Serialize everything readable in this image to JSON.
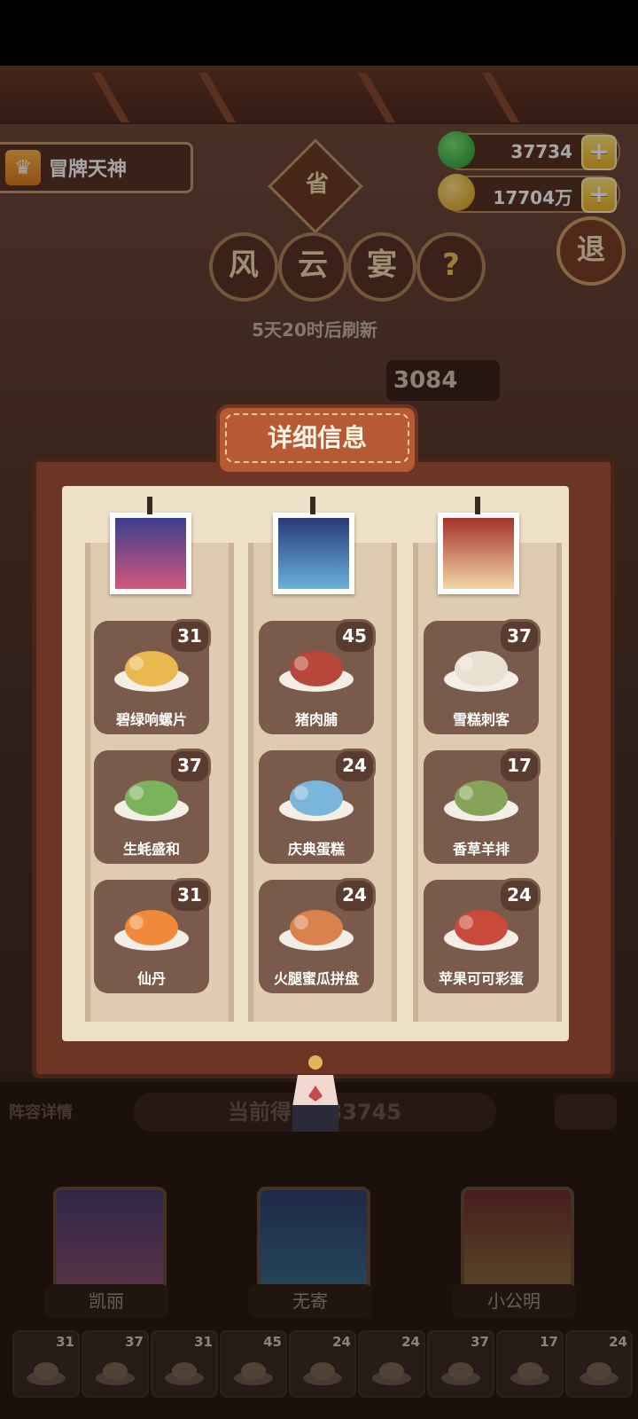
{
  "header": {
    "title": "冒牌天神",
    "green_currency": "37734",
    "gold_currency": "17704万",
    "province_badge": "省",
    "event_chars": [
      "风",
      "云",
      "宴"
    ],
    "help_label": "?",
    "exit_label": "退",
    "refresh_text": "5天20时后刷新",
    "score_chip": "3084"
  },
  "modal": {
    "title": "详细信息",
    "columns": [
      {
        "dishes": [
          {
            "name": "碧绿响螺片",
            "count": "31"
          },
          {
            "name": "生蚝盛和",
            "count": "37"
          },
          {
            "name": "仙丹",
            "count": "31"
          }
        ]
      },
      {
        "dishes": [
          {
            "name": "猪肉脯",
            "count": "45"
          },
          {
            "name": "庆典蛋糕",
            "count": "24"
          },
          {
            "name": "火腿蜜瓜拼盘",
            "count": "24"
          }
        ]
      },
      {
        "dishes": [
          {
            "name": "雪糕刺客",
            "count": "37"
          },
          {
            "name": "香草羊排",
            "count": "17"
          },
          {
            "name": "苹果可可彩蛋",
            "count": "24"
          }
        ]
      }
    ]
  },
  "bottom": {
    "lineup_label": "阵容详情",
    "current_score": "当前得分833745",
    "heroes": [
      {
        "name": "凯丽"
      },
      {
        "name": "无寄"
      },
      {
        "name": "小公明"
      }
    ],
    "slots": [
      "31",
      "37",
      "31",
      "45",
      "24",
      "24",
      "37",
      "17",
      "24"
    ]
  },
  "colors": {
    "accent_gold": "#f2b51d",
    "frame_brown": "#6d3524",
    "paper": "#efe0c8"
  }
}
